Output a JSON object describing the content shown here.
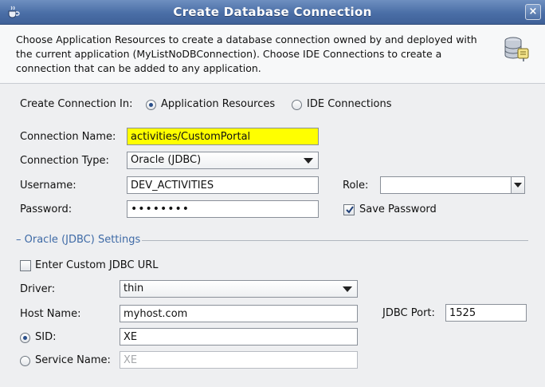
{
  "window": {
    "title": "Create Database Connection",
    "close_label": "×"
  },
  "header": {
    "description": "Choose Application Resources to create a database connection owned by and deployed with the current application (MyListNoDBConnection). Choose IDE Connections to create a connection that can be added to any application."
  },
  "create_in": {
    "label": "Create Connection In:",
    "options": [
      {
        "label": "Application Resources",
        "checked": true
      },
      {
        "label": "IDE Connections",
        "checked": false
      }
    ]
  },
  "connection": {
    "name_label": "Connection Name:",
    "name_value": "activities/CustomPortal",
    "type_label": "Connection Type:",
    "type_value": "Oracle (JDBC)",
    "username_label": "Username:",
    "username_value": "DEV_ACTIVITIES",
    "password_label": "Password:",
    "password_value": "••••••••",
    "role_label": "Role:",
    "role_value": "",
    "save_password_label": "Save Password",
    "save_password_checked": true
  },
  "oracle_settings": {
    "section_title": "– Oracle (JDBC) Settings",
    "custom_url_label": "Enter Custom JDBC URL",
    "custom_url_checked": false,
    "driver_label": "Driver:",
    "driver_value": "thin",
    "host_label": "Host Name:",
    "host_value": "myhost.com",
    "port_label": "JDBC Port:",
    "port_value": "1525",
    "sid_label": "SID:",
    "sid_value": "XE",
    "sid_checked": true,
    "service_label": "Service Name:",
    "service_value": "XE",
    "service_checked": false
  }
}
